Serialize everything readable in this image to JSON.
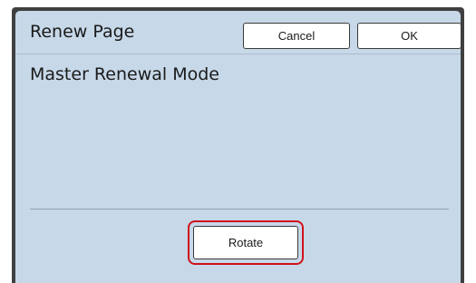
{
  "dialog": {
    "title": "Renew Page",
    "cancel_label": "Cancel",
    "ok_label": "OK",
    "mode_label": "Master Renewal Mode",
    "rotate_label": "Rotate"
  },
  "colors": {
    "panel_background": "#c7d8e8",
    "frame": "#404040",
    "highlight": "#d0121b"
  }
}
